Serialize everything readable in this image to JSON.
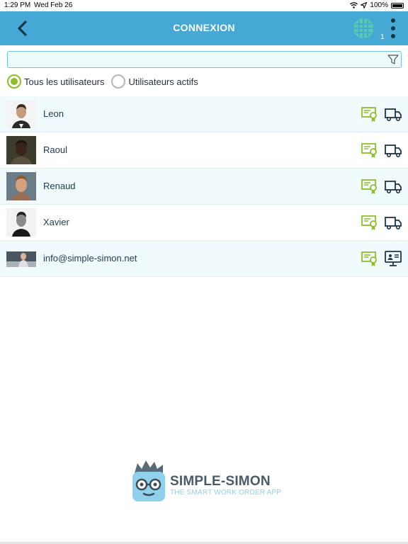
{
  "status_bar": {
    "time": "1:29 PM",
    "date": "Wed Feb 26",
    "battery": "100%"
  },
  "header": {
    "title": "CONNEXION",
    "badge_count": "1"
  },
  "search": {
    "value": "",
    "placeholder": ""
  },
  "filters": {
    "all_users": "Tous les utilisateurs",
    "active_users": "Utilisateurs actifs",
    "selected": "all_users"
  },
  "users": [
    {
      "name": "Leon",
      "icons": [
        "certificate-icon",
        "truck-icon"
      ]
    },
    {
      "name": "Raoul",
      "icons": [
        "certificate-icon",
        "truck-icon"
      ]
    },
    {
      "name": "Renaud",
      "icons": [
        "certificate-icon",
        "truck-icon"
      ]
    },
    {
      "name": "Xavier",
      "icons": [
        "certificate-icon",
        "truck-icon"
      ]
    },
    {
      "name": "info@simple-simon.net",
      "icons": [
        "certificate-icon",
        "monitor-icon"
      ]
    }
  ],
  "logo": {
    "name": "SIMPLE-SIMON",
    "tagline": "THE SMART WORK ORDER APP"
  },
  "colors": {
    "header": "#46a8d4",
    "accent_green": "#8cbf26",
    "dark_icon": "#1d3446",
    "row_alt": "#f1fafd"
  }
}
